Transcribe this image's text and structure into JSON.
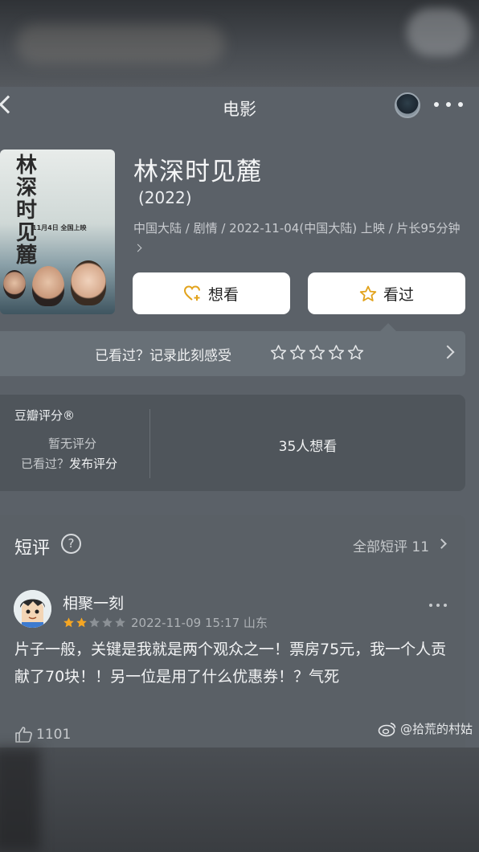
{
  "nav": {
    "title": "电影"
  },
  "movie": {
    "title": "林深时见麓",
    "year": "(2022)",
    "meta": "中国大陆 / 剧情 / 2022-11-04(中国大陆) 上映 / 片长95分钟",
    "poster": {
      "title": "林深时见麓",
      "date": "11月4日 全国上映"
    }
  },
  "actions": {
    "want_label": "想看",
    "seen_label": "看过"
  },
  "record": {
    "prompt": "已看过？记录此刻感受",
    "star_count": 5
  },
  "rating": {
    "label": "豆瓣评分®",
    "no_score": "暂无评分",
    "seen_prefix": "已看过？",
    "publish_label": "发布评分",
    "want_count": "35人想看"
  },
  "reviews": {
    "title": "短评",
    "help_symbol": "?",
    "all_label": "全部短评 11",
    "items": [
      {
        "user": "相聚一刻",
        "rating": 2,
        "max_rating": 5,
        "time": "2022-11-09 15:17 山东",
        "text": "片子一般，关键是我就是两个观众之一！票房75元，我一个人贡献了70块！！另一位是用了什么优惠券！？气死",
        "likes": "1101"
      }
    ]
  },
  "watermark": {
    "text": "@拾荒的村姑"
  },
  "colors": {
    "accent_star": "#f5a623",
    "button_bg": "#ffffff",
    "card_bg": "#4f555b"
  }
}
